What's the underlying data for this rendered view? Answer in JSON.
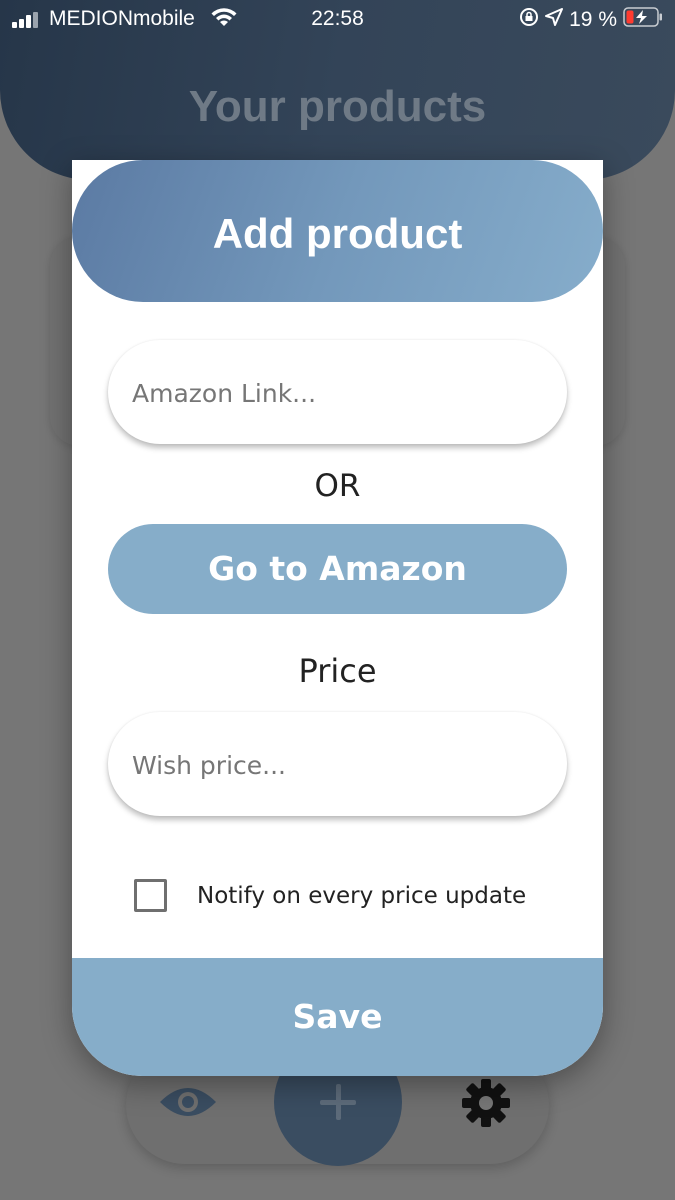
{
  "status_bar": {
    "carrier": "MEDIONmobile",
    "time": "22:58",
    "battery_text": "19 %",
    "icons": [
      "signal-icon",
      "wifi-icon",
      "rotation-lock-icon",
      "location-arrow-icon",
      "battery-charging-icon"
    ]
  },
  "app": {
    "title": "Your products",
    "nav": {
      "icons": [
        "eye-icon",
        "plus-icon",
        "gear-icon"
      ]
    }
  },
  "modal": {
    "title": "Add product",
    "amazon_link": {
      "placeholder": "Amazon Link...",
      "value": ""
    },
    "or_label": "OR",
    "go_to_amazon_label": "Go to Amazon",
    "price_label": "Price",
    "wish_price": {
      "placeholder": "Wish price...",
      "value": ""
    },
    "notify_label": "Notify on every price update",
    "notify_checked": false,
    "save_label": "Save"
  },
  "colors": {
    "accent": "#86adc9",
    "header_gradient_start": "#5b7aa3",
    "header_gradient_end": "#86adcb",
    "app_header": "#334458"
  }
}
